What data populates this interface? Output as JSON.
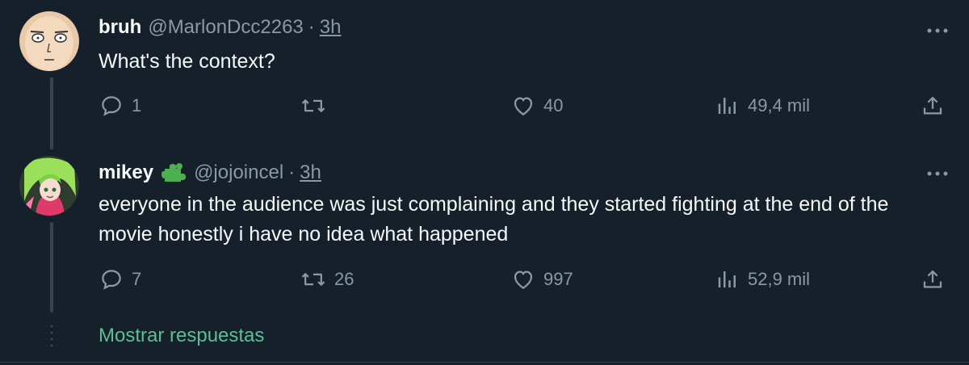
{
  "tweets": [
    {
      "display_name": "bruh",
      "handle": "@MarlonDcc2263",
      "separator": "·",
      "time": "3h",
      "text": "What's the context?",
      "replies": "1",
      "retweets": "",
      "likes": "40",
      "views": "49,4 mil",
      "avatar_icon": "cartoon-face-avatar"
    },
    {
      "display_name": "mikey",
      "badge_icon": "puzzle-piece-icon",
      "handle": "@jojoincel",
      "separator": "·",
      "time": "3h",
      "text": "everyone in the audience was just complaining and they started fighting at the end of the movie honestly i have no idea what happened",
      "replies": "7",
      "retweets": "26",
      "likes": "997",
      "views": "52,9 mil",
      "avatar_icon": "anime-character-avatar"
    }
  ],
  "show_replies_label": "Mostrar respuestas",
  "colors": {
    "background": "#15202b",
    "text": "#f7f9f9",
    "muted": "#8b98a5",
    "link": "#5cbd96",
    "badge": "#4caf50",
    "divider": "#38444d"
  }
}
